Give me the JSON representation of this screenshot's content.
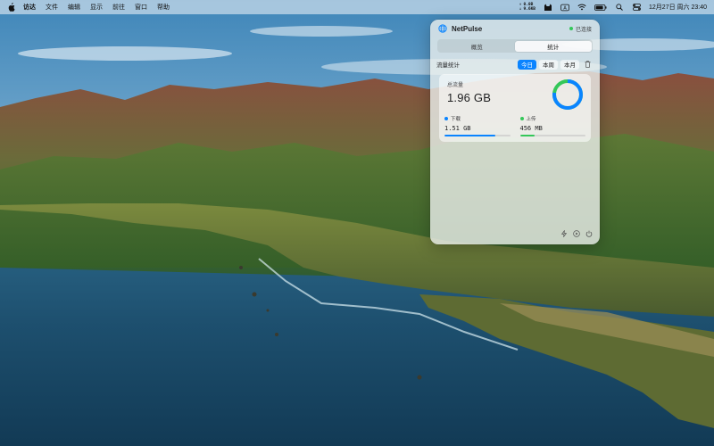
{
  "menubar": {
    "app_name": "访达",
    "menus": [
      "文件",
      "编辑",
      "显示",
      "前往",
      "窗口",
      "帮助"
    ],
    "speed_up": "0.0B",
    "speed_down": "9.6KB",
    "clock": "12月27日 周六  23:40",
    "tray_icons": [
      "cat-icon",
      "input-method-icon",
      "wifi-icon",
      "battery-icon",
      "spotlight-icon",
      "control-center-icon"
    ]
  },
  "panel": {
    "app_title": "NetPulse",
    "status": "已连接",
    "tabs": [
      "概览",
      "统计"
    ],
    "active_tab": "统计",
    "stats_label": "流量统计",
    "periods": [
      "今日",
      "本周",
      "本月"
    ],
    "active_period": "今日",
    "total_label": "总流量",
    "total_value": "1.96 GB",
    "download_label": "下载",
    "download_value": "1.51 GB",
    "upload_label": "上传",
    "upload_value": "456 MB",
    "download_fraction": 0.77,
    "upload_fraction": 0.23,
    "footer_icons": [
      "activity-icon",
      "play-icon",
      "power-icon"
    ]
  },
  "colors": {
    "accent": "#0a84ff",
    "download": "#0a84ff",
    "upload": "#34c759",
    "connected": "#34c759"
  }
}
